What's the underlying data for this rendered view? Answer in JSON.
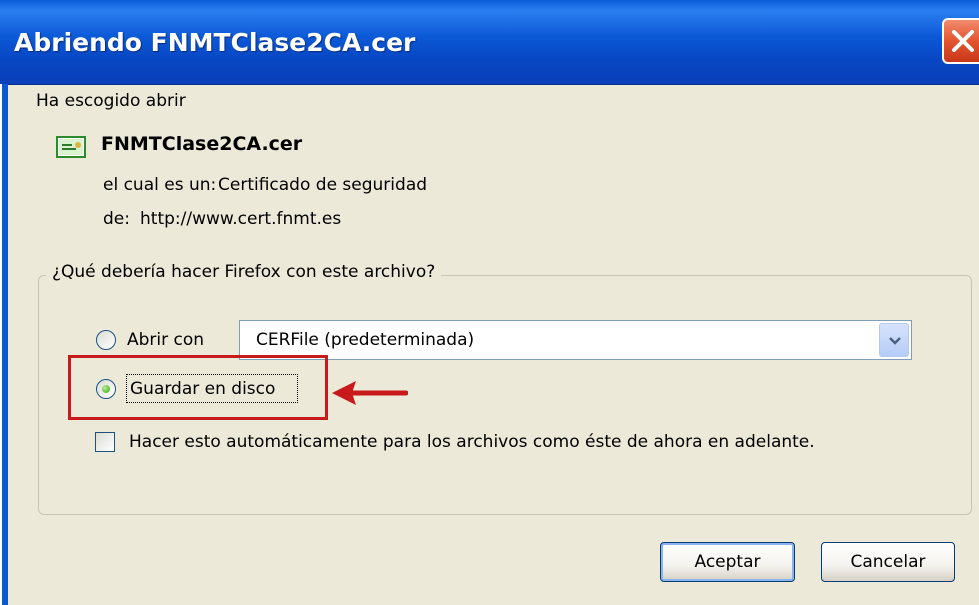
{
  "window": {
    "title": "Abriendo FNMTClase2CA.cer"
  },
  "intro_text": "Ha escogido abrir",
  "file": {
    "icon": "certificate-file-icon",
    "name": "FNMTClase2CA.cer",
    "type_label": "el cual es un:",
    "type_value": "Certificado de seguridad",
    "from_label": "de:",
    "from_value": "http://www.cert.fnmt.es"
  },
  "group": {
    "legend": "¿Qué debería hacer Firefox con este archivo?",
    "open_with": {
      "label": "Abrir con",
      "selected": false,
      "app_selected": "CERFile (predeterminada)"
    },
    "save_to_disk": {
      "label": "Guardar en disco",
      "selected": true
    },
    "auto_checkbox": {
      "label": "Hacer esto automáticamente para los archivos como éste de ahora en adelante.",
      "checked": false
    }
  },
  "buttons": {
    "ok": "Aceptar",
    "cancel": "Cancelar"
  },
  "colors": {
    "titlebar": "#0b58d5",
    "dialog_bg": "#ece9d8",
    "annotation": "#c8191b",
    "close_button": "#e3552f"
  }
}
